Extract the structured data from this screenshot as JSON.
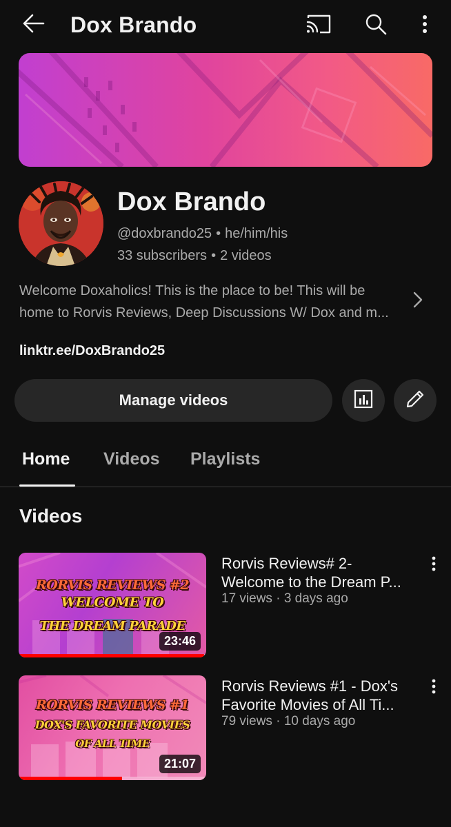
{
  "topbar": {
    "title": "Dox Brando"
  },
  "icons": {
    "back": "arrow-left",
    "cast": "cast",
    "search": "magnifier",
    "more": "vertical-dots",
    "chevron": "chevron-right",
    "analytics": "bar-chart",
    "edit": "pencil"
  },
  "channel": {
    "name": "Dox Brando",
    "handle": "@doxbrando25",
    "pronouns": "he/him/his",
    "subscribers": "33 subscribers",
    "video_count": "2 videos",
    "separator": "•",
    "description_line1": "Welcome Doxaholics! This is the place to be! This will be",
    "description_line2": "home to Rorvis Reviews, Deep Discussions W/ Dox and m...",
    "link": "linktr.ee/DoxBrando25"
  },
  "actions": {
    "manage_label": "Manage videos"
  },
  "tabs": [
    {
      "label": "Home",
      "active": true
    },
    {
      "label": "Videos",
      "active": false
    },
    {
      "label": "Playlists",
      "active": false
    }
  ],
  "section": {
    "title": "Videos"
  },
  "videos": [
    {
      "title_line1": "Rorvis Reviews# 2-",
      "title_line2": "Welcome to the Dream P...",
      "views": "17 views",
      "age": "3 days ago",
      "meta_sep": "·",
      "duration": "23:46",
      "watched_fraction": 0.99,
      "thumb_line1": "RORVIS REVIEWS #2",
      "thumb_line2": "WELCOME TO",
      "thumb_line3": "THE DREAM PARADE"
    },
    {
      "title_line1": "Rorvis Reviews #1 - Dox's",
      "title_line2": "Favorite Movies of All Ti...",
      "views": "79 views",
      "age": "10 days ago",
      "meta_sep": "·",
      "duration": "21:07",
      "watched_fraction": 0.55,
      "thumb_line1": "RORVIS REVIEWS #1",
      "thumb_line2": "DOX'S FAVORITE MOVIES",
      "thumb_line3": "OF ALL TIME"
    }
  ],
  "colors": {
    "background": "#0f0f0f",
    "surface": "#272727",
    "text_primary": "#f1f1f1",
    "text_secondary": "#aaaaaa",
    "progress": "#ff0000"
  }
}
